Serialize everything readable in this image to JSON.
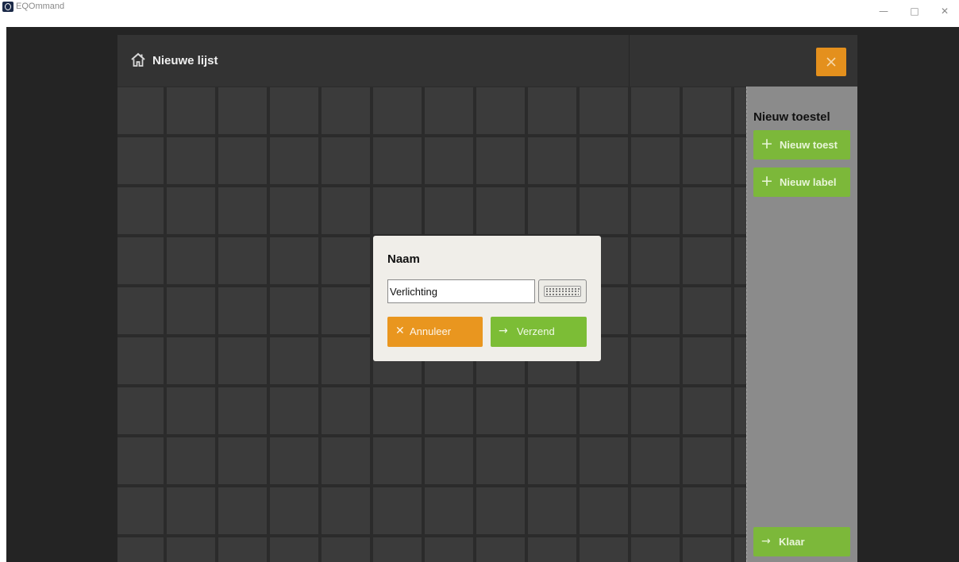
{
  "window": {
    "title": "EQOmmand",
    "icons": {
      "app": "app-logo-icon",
      "minimize": "minimize-icon",
      "maximize": "maximize-icon",
      "close": "window-close-icon"
    }
  },
  "header": {
    "title": "Nieuwe lijst",
    "icons": {
      "home": "home-icon",
      "close": "close-icon"
    }
  },
  "sidebar": {
    "heading": "Nieuw toestel",
    "buttons": [
      {
        "label": "Nieuw toest",
        "icon": "plus-icon"
      },
      {
        "label": "Nieuw label",
        "icon": "plus-icon"
      }
    ],
    "done_label": "Klaar",
    "done_icon": "arrow-right-icon"
  },
  "dialog": {
    "title": "Naam",
    "input_value": "Verlichting",
    "keyboard_icon": "keyboard-icon",
    "cancel_label": "Annuleer",
    "cancel_icon": "x-icon",
    "send_label": "Verzend",
    "send_icon": "arrow-right-icon"
  },
  "colors": {
    "accent_orange": "#e4901d",
    "accent_green": "#7cb83a",
    "background": "#242424",
    "grid": "#3b3b3b",
    "sidebar": "#8b8b8b",
    "dialog": "#f0eee9"
  }
}
